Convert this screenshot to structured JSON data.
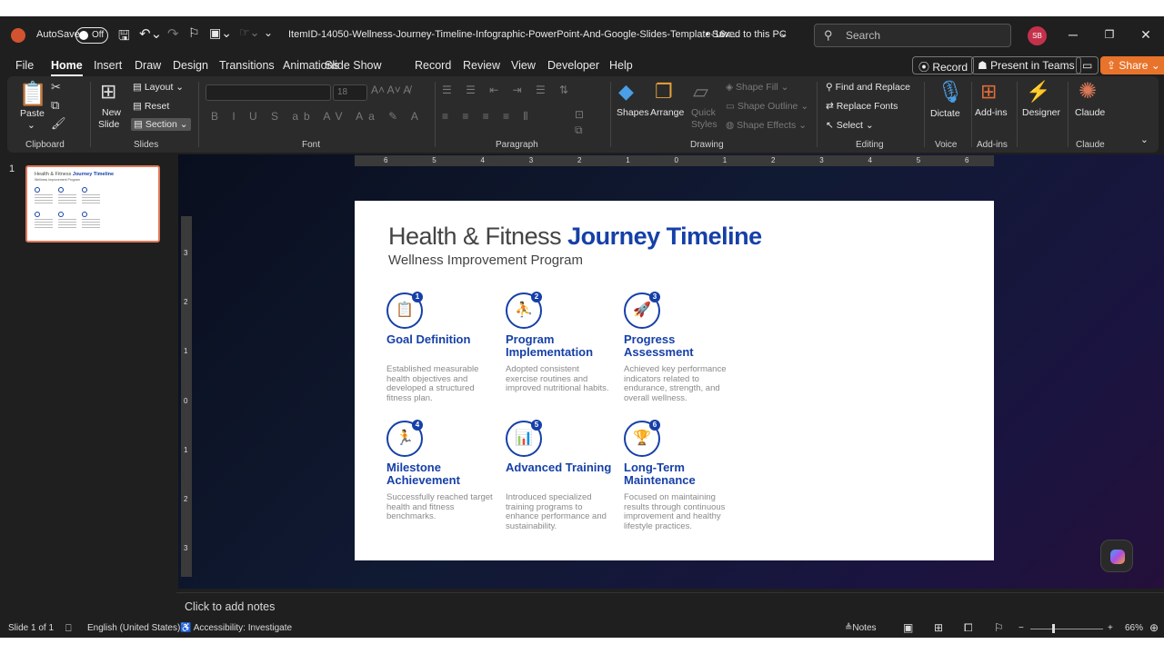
{
  "titlebar": {
    "autosave_label": "AutoSave",
    "autosave_state": "Off",
    "doc_title": "ItemID-14050-Wellness-Journey-Timeline-Infographic-PowerPoint-And-Google-Slides-Template-16x...",
    "save_status": "• Saved to this PC",
    "search_placeholder": "Search",
    "user_initials": "SB"
  },
  "menu": {
    "tabs": [
      "File",
      "Home",
      "Insert",
      "Draw",
      "Design",
      "Transitions",
      "Animations",
      "Slide Show",
      "Record",
      "Review",
      "View",
      "Developer",
      "Help"
    ],
    "active_tab": "Home",
    "record_btn": "Record",
    "present_btn": "Present in Teams",
    "share_btn": "Share"
  },
  "ribbon": {
    "clipboard": {
      "label": "Clipboard",
      "paste": "Paste"
    },
    "slides": {
      "label": "Slides",
      "new_slide": "New",
      "new_slide2": "Slide",
      "layout": "Layout",
      "reset": "Reset",
      "section": "Section"
    },
    "font": {
      "label": "Font",
      "size": "18"
    },
    "paragraph": {
      "label": "Paragraph"
    },
    "drawing": {
      "label": "Drawing",
      "shapes": "Shapes",
      "arrange": "Arrange",
      "quick_styles": "Quick",
      "quick_styles2": "Styles",
      "shape_fill": "Shape Fill",
      "shape_outline": "Shape Outline",
      "shape_effects": "Shape Effects"
    },
    "editing": {
      "label": "Editing",
      "find_replace": "Find and Replace",
      "replace_fonts": "Replace Fonts",
      "select": "Select"
    },
    "voice": {
      "label": "Voice",
      "dictate": "Dictate"
    },
    "addins": {
      "label": "Add-ins",
      "addins": "Add-ins"
    },
    "designer": {
      "label": "Designer"
    },
    "claude": {
      "label": "Claude",
      "claude": "Claude"
    }
  },
  "thumbnails": [
    {
      "number": "1"
    }
  ],
  "slide": {
    "title_main": "Health & Fitness ",
    "title_accent": "Journey Timeline",
    "subtitle": "Wellness Improvement Program",
    "steps": [
      {
        "num": "1",
        "name": "Goal Definition",
        "desc": "Established measurable health objectives and developed a structured fitness plan.",
        "icon": "clipboard-icon"
      },
      {
        "num": "2",
        "name": "Program Implementation",
        "desc": "Adopted consistent exercise routines and improved nutritional habits.",
        "icon": "workout-icon"
      },
      {
        "num": "3",
        "name": "Progress Assessment",
        "desc": "Achieved key performance indicators related to endurance, strength, and overall wellness.",
        "icon": "rocket-icon"
      },
      {
        "num": "4",
        "name": "Milestone Achievement",
        "desc": "Successfully reached target health and fitness benchmarks.",
        "icon": "person-icon"
      },
      {
        "num": "5",
        "name": "Advanced Training",
        "desc": "Introduced specialized training programs to enhance performance and sustainability.",
        "icon": "chart-icon"
      },
      {
        "num": "6",
        "name": "Long-Term Maintenance",
        "desc": "Focused on maintaining results through continuous improvement and healthy lifestyle practices.",
        "icon": "trophy-icon"
      }
    ]
  },
  "notes": {
    "placeholder": "Click to add notes"
  },
  "status": {
    "slide_count": "Slide 1 of 1",
    "language": "English (United States)",
    "accessibility": "Accessibility: Investigate",
    "notes": "Notes",
    "zoom": "66%"
  },
  "hruler_ticks": [
    "6",
    "5",
    "4",
    "3",
    "2",
    "1",
    "0",
    "1",
    "2",
    "3",
    "4",
    "5",
    "6"
  ],
  "vruler_ticks": [
    "3",
    "2",
    "1",
    "0",
    "1",
    "2",
    "3"
  ]
}
